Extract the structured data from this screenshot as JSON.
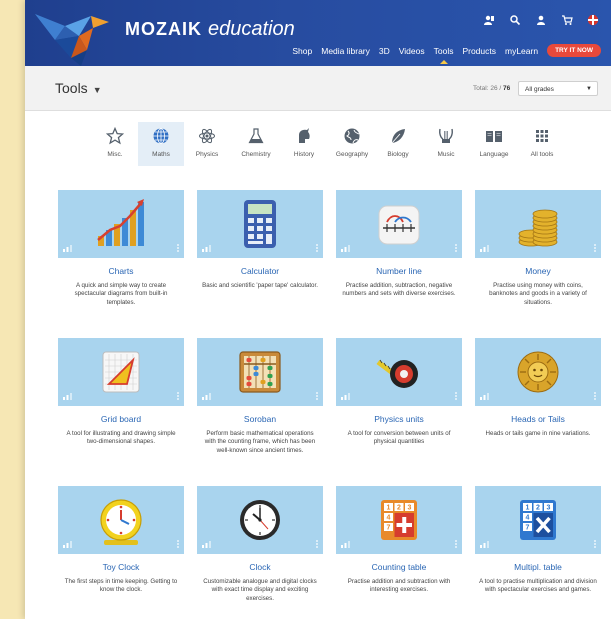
{
  "brand": {
    "name": "MOZAIK",
    "suffix": "education"
  },
  "nav": {
    "items": [
      "Shop",
      "Media library",
      "3D",
      "Videos",
      "Tools",
      "Products",
      "myLearn"
    ],
    "active": "Tools",
    "try_button": "TRY IT NOW"
  },
  "top_icons": [
    "student-icon",
    "search-icon",
    "user-icon",
    "cart-icon",
    "language-flag-icon"
  ],
  "titlebar": {
    "title": "Tools",
    "total_label": "Total: 26 /",
    "total_value": "76",
    "grade_selected": "All grades"
  },
  "categories": [
    {
      "label": "Misc.",
      "icon": "star-icon"
    },
    {
      "label": "Maths",
      "icon": "globe-grid-icon",
      "active": true
    },
    {
      "label": "Physics",
      "icon": "atom-icon"
    },
    {
      "label": "Chemistry",
      "icon": "flask-icon"
    },
    {
      "label": "History",
      "icon": "helmet-icon"
    },
    {
      "label": "Geography",
      "icon": "globe-icon"
    },
    {
      "label": "Biology",
      "icon": "leaf-icon"
    },
    {
      "label": "Music",
      "icon": "lyre-icon"
    },
    {
      "label": "Language",
      "icon": "book-icon"
    },
    {
      "label": "All tools",
      "icon": "grid-dots-icon"
    }
  ],
  "tools": [
    {
      "title": "Charts",
      "desc": "A quick and simple way to create spectacular diagrams from built-in templates."
    },
    {
      "title": "Calculator",
      "desc": "Basic and scientific 'paper tape' calculator."
    },
    {
      "title": "Number line",
      "desc": "Practise addition, subtraction, negative numbers and sets with diverse exercises."
    },
    {
      "title": "Money",
      "desc": "Practise using money with coins, banknotes and goods in a variety of situations."
    },
    {
      "title": "Grid board",
      "desc": "A tool for illustrating and drawing simple two-dimensional shapes."
    },
    {
      "title": "Soroban",
      "desc": "Perform basic mathematical operations with the counting frame, which has been well-known since ancient times."
    },
    {
      "title": "Physics units",
      "desc": "A tool for conversion between units of physical quantities"
    },
    {
      "title": "Heads or Tails",
      "desc": "Heads or tails game in nine variations."
    },
    {
      "title": "Toy Clock",
      "desc": "The first steps in time keeping. Getting to know the clock."
    },
    {
      "title": "Clock",
      "desc": "Customizable analogue and digital clocks with exact time display and exciting exercises."
    },
    {
      "title": "Counting table",
      "desc": "Practise addition and subtraction with interesting exercises."
    },
    {
      "title": "Multipl. table",
      "desc": "A tool to practise multiplication and division with spectacular exercises and games."
    }
  ],
  "colors": {
    "header": "#274ca0",
    "accent_button": "#e8493b",
    "card_bg": "#a9d4ee",
    "title_link": "#2a66b4"
  }
}
